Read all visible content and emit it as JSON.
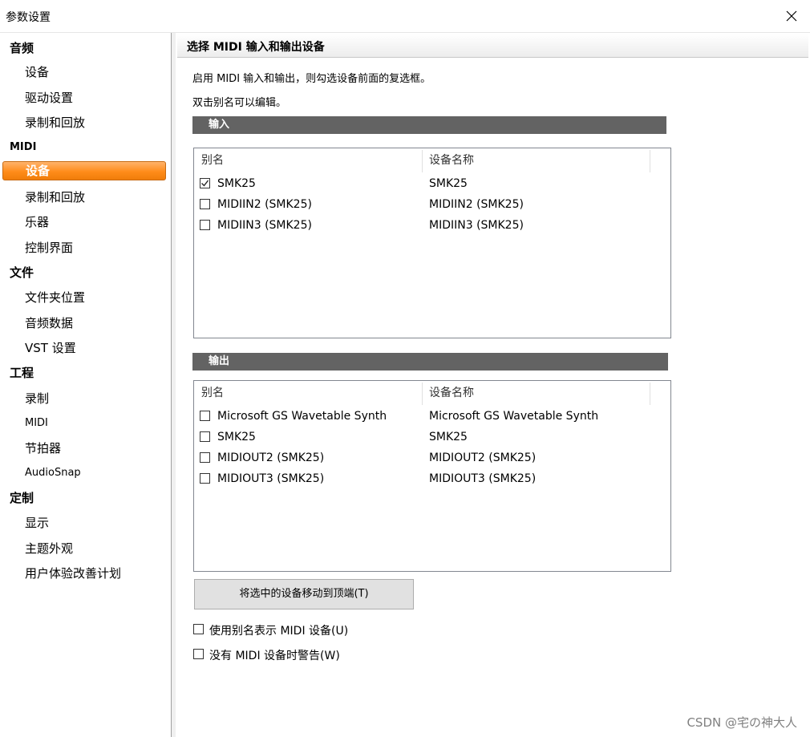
{
  "window": {
    "title": "参数设置"
  },
  "sidebar": {
    "groups": [
      {
        "label": "音频",
        "items": [
          "设备",
          "驱动设置",
          "录制和回放"
        ]
      },
      {
        "label": "MIDI",
        "items": [
          "设备",
          "录制和回放",
          "乐器",
          "控制界面"
        ],
        "selected": 0
      },
      {
        "label": "文件",
        "items": [
          "文件夹位置",
          "音频数据",
          "VST 设置"
        ]
      },
      {
        "label": "工程",
        "items": [
          "录制",
          "MIDI",
          "节拍器",
          "AudioSnap"
        ]
      },
      {
        "label": "定制",
        "items": [
          "显示",
          "主题外观",
          "用户体验改善计划"
        ]
      }
    ]
  },
  "main": {
    "header": "选择 MIDI 输入和输出设备",
    "desc1": "启用 MIDI 输入和输出，则勾选设备前面的复选框。",
    "desc2": "双击别名可以编辑。",
    "input": {
      "label": "输入",
      "columns": [
        "别名",
        "设备名称"
      ],
      "rows": [
        {
          "alias": "SMK25",
          "device": "SMK25",
          "checked": true
        },
        {
          "alias": "MIDIIN2 (SMK25)",
          "device": "MIDIIN2 (SMK25)",
          "checked": false
        },
        {
          "alias": "MIDIIN3 (SMK25)",
          "device": "MIDIIN3 (SMK25)",
          "checked": false
        }
      ]
    },
    "output": {
      "label": "输出",
      "columns": [
        "别名",
        "设备名称"
      ],
      "rows": [
        {
          "alias": "Microsoft GS Wavetable Synth",
          "device": "Microsoft GS Wavetable Synth",
          "checked": false
        },
        {
          "alias": "SMK25",
          "device": "SMK25",
          "checked": false
        },
        {
          "alias": "MIDIOUT2 (SMK25)",
          "device": "MIDIOUT2 (SMK25)",
          "checked": false
        },
        {
          "alias": "MIDIOUT3 (SMK25)",
          "device": "MIDIOUT3 (SMK25)",
          "checked": false
        }
      ]
    },
    "move_button": "将选中的设备移动到顶端(T)",
    "use_alias_option": "使用别名表示 MIDI 设备(U)",
    "warn_option": "没有 MIDI 设备时警告(W)"
  },
  "watermark": "CSDN @宅の神大人",
  "colors": {
    "selected_bg": "#ff8c1a",
    "group_header_bg": "#636363"
  },
  "icons": {
    "close": "close-icon",
    "check": "checkmark-icon"
  }
}
